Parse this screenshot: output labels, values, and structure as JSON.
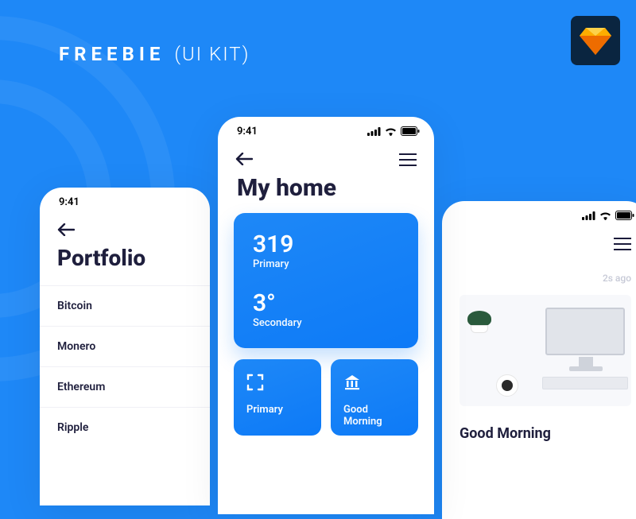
{
  "banner": {
    "title_bold": "FREEBIE",
    "title_light": "(UI KIT)"
  },
  "statusbar": {
    "time": "9:41"
  },
  "left": {
    "title": "Portfolio",
    "items": [
      "Bitcoin",
      "Monero",
      "Ethereum",
      "Ripple"
    ]
  },
  "center": {
    "title": "My home",
    "card": {
      "primary_value": "319",
      "primary_label": "Primary",
      "secondary_value": "3°",
      "secondary_label": "Secondary"
    },
    "small": {
      "left_label": "Primary",
      "right_label": "Good Morning"
    }
  },
  "right": {
    "time_ago": "2s ago",
    "greeting": "Good Morning"
  }
}
